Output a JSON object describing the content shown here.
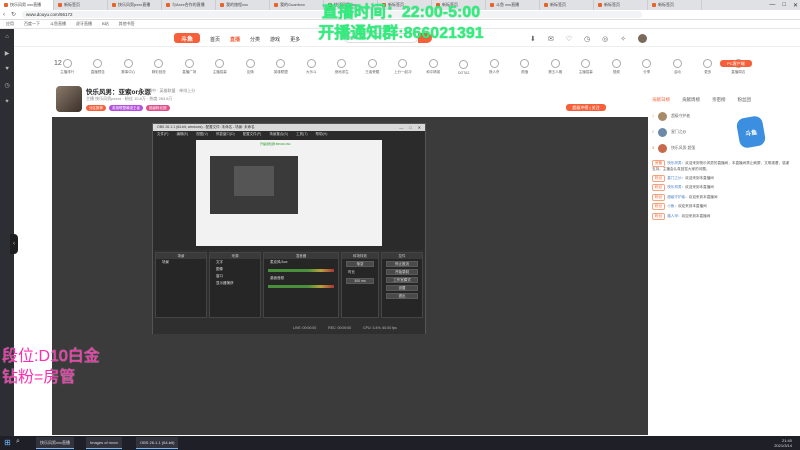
{
  "browser": {
    "tabs": [
      "快乐风男 xxx直播",
      "新标签页",
      "快乐风男pxxx直播",
      "与Axxx合作的直播",
      "我的旅程xxx",
      "我的Guanfxxx",
      "快乐风男xxx",
      "新标签页",
      "新标签页",
      "斗鱼 xxx直播",
      "新标签页",
      "新标签页",
      "新标签页"
    ],
    "url": "www.douyu.com/66172",
    "bookmarks": [
      "应用",
      "百度一下",
      "斗鱼直播",
      "虎牙直播",
      "B站",
      "其他书签"
    ],
    "window_controls": [
      "—",
      "□",
      "✕"
    ]
  },
  "overlay": {
    "top_line1": "直播时间：22:00-5:00",
    "top_line2": "开播通知群:866021391",
    "bottom_line1": "段位:D10白金",
    "bottom_line2": "钻粉=房管"
  },
  "header": {
    "logo": "斗鱼",
    "nav": [
      "首页",
      "直播",
      "分类",
      "游戏",
      "更多"
    ],
    "search_placeholder": "搜索"
  },
  "rank": "12",
  "categories": [
    "主播排行",
    "直播预告",
    "赛事中心",
    "精彩回放",
    "直播广场",
    "主播招募",
    "友情",
    "英雄联盟",
    "大乐斗",
    "绝地求生",
    "王者荣耀",
    "上分一起冲",
    "和平精英",
    "DOTA2",
    "狼人杀",
    "颜值",
    "第五人格",
    "主播招募",
    "视频",
    "分享",
    "活动",
    "更多",
    "直播周边",
    "星秀",
    "游戏中心",
    "主播电台",
    "全部",
    "收藏",
    "更多"
  ],
  "pc_client": "PC客户端",
  "streamer": {
    "name": "快乐风男：亚索or永恩",
    "note": "直播中 · 英雄联盟 · 单排上分",
    "line2": "主播 快乐风男pxxxx  · 粉丝 10.8万  · 热度 283.8万",
    "badges": [
      "分区推荐",
      "英雄联盟最强王者",
      "超级粉丝团"
    ],
    "hot_tag": "超级冲榜 | 关注"
  },
  "obs": {
    "title": "OBS 26.1.1 (64-bit, windows) - 配置文件: 未命名 - 场景: 未命名",
    "menu": [
      "文件(F)",
      "编辑(E)",
      "视图(V)",
      "停靠窗口(D)",
      "配置文件(P)",
      "场景集合(S)",
      "工具(T)",
      "帮助(H)"
    ],
    "preview_green": "开播通知群:866021391",
    "panels": {
      "scenes": "场景",
      "sources": "来源",
      "mixer": "混音器",
      "transitions": "转场特效",
      "controls": "控件"
    },
    "scene_items": [
      "场景"
    ],
    "source_items": [
      "文字",
      "图像",
      "窗口",
      "显示器捕获"
    ],
    "mixer_tracks": [
      "麦克风/Aux",
      "桌面音频"
    ],
    "transition_value": "渐变",
    "duration_label": "时长",
    "duration_value": "300 ms",
    "control_buttons": [
      "停止推流",
      "开始录制",
      "工作室模式",
      "设置",
      "退出"
    ],
    "status": [
      "LIVE: 00:00:00",
      "REC: 00:00:00",
      "CPU: 3.4%, 60.00 fps"
    ]
  },
  "side": {
    "tabs": [
      "贡献日榜",
      "贡献周榜",
      "亲密榜",
      "粉丝团"
    ],
    "fans": [
      {
        "name": "超级守护者",
        "rank": "1"
      },
      {
        "name": "星门之纱",
        "rank": "2"
      },
      {
        "name": "快乐风男·超强",
        "rank": "3"
      }
    ],
    "mascot": "斗鱼",
    "chat": [
      {
        "tag": "房管",
        "name": "快乐风男",
        "text": "欢迎来到快乐风男的直播间，本直播间禁止刷屏，文明观看，感谢支持，主播会认真回答大家的问题。"
      },
      {
        "tag": "粉丝",
        "name": "星门之纱",
        "text": "欢迎来到本直播间"
      },
      {
        "tag": "粉丝",
        "name": "快乐风男",
        "text": "欢迎来到本直播间"
      },
      {
        "tag": "粉丝",
        "name": "超级守护者",
        "text": "欢迎来到本直播间"
      },
      {
        "tag": "粉丝",
        "name": "小鱼",
        "text": "欢迎来到本直播间"
      },
      {
        "tag": "粉丝",
        "name": "路人甲",
        "text": "欢迎来到本直播间"
      }
    ]
  },
  "taskbar": {
    "start": "⊞",
    "search": "⌕",
    "tasks": [
      "快乐风男xxx直播",
      "Images of mxxx",
      "OBS 26.1.1 (64-bit)"
    ],
    "time": "21:40",
    "date": "2021/3/14"
  },
  "colors": {
    "accent": "#f5603a",
    "overlay_green": "#2ef07a",
    "overlay_pink": "#ff2db0"
  }
}
